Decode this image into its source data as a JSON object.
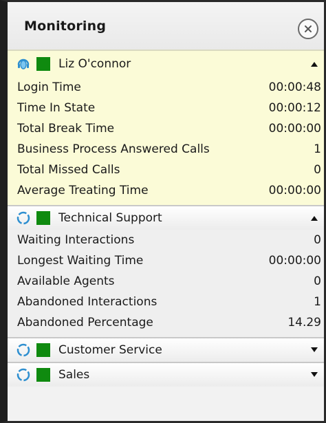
{
  "panel": {
    "title": "Monitoring"
  },
  "agent": {
    "name": "Liz O'connor",
    "status_color": "#0f8a0f",
    "expanded": true,
    "metrics": [
      {
        "label": "Login Time",
        "value": "00:00:48"
      },
      {
        "label": "Time In State",
        "value": "00:00:12"
      },
      {
        "label": "Total Break Time",
        "value": "00:00:00"
      },
      {
        "label": "Business Process Answered Calls",
        "value": "1"
      },
      {
        "label": "Total Missed Calls",
        "value": "0"
      },
      {
        "label": "Average Treating Time",
        "value": "00:00:00"
      }
    ]
  },
  "queues": [
    {
      "name": "Technical Support",
      "expanded": true,
      "metrics": [
        {
          "label": "Waiting Interactions",
          "value": "0"
        },
        {
          "label": "Longest Waiting Time",
          "value": "00:00:00"
        },
        {
          "label": "Available Agents",
          "value": "0"
        },
        {
          "label": "Abandoned Interactions",
          "value": "1"
        },
        {
          "label": "Abandoned Percentage",
          "value": "14.29"
        }
      ]
    },
    {
      "name": "Customer Service",
      "expanded": false
    },
    {
      "name": "Sales",
      "expanded": false
    }
  ],
  "icons": {
    "close": "close-circle-icon",
    "agent": "headset-icon",
    "queue": "refresh-circle-icon",
    "status": "status-square-icon",
    "collapse": "chevron-up-icon",
    "expand": "chevron-down-icon"
  }
}
